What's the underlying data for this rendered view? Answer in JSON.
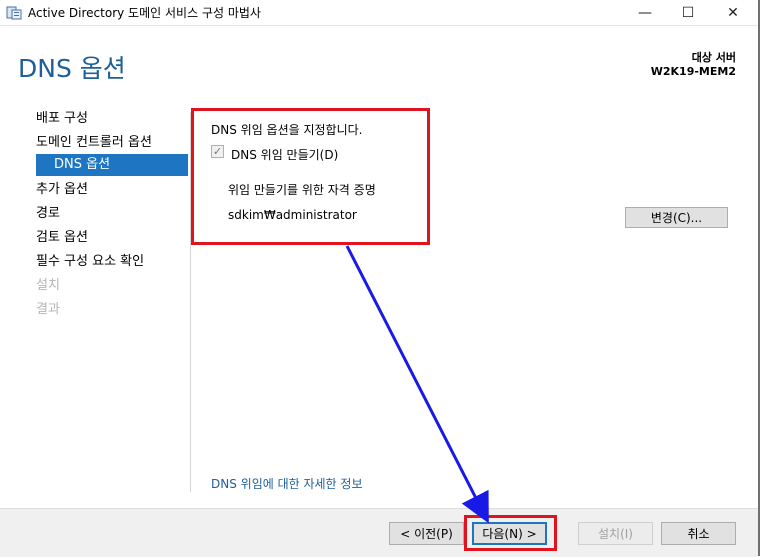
{
  "window": {
    "title": "Active Directory 도메인 서비스 구성 마법사",
    "controls": {
      "minimize": "—",
      "maximize": "☐",
      "close": "✕"
    }
  },
  "header": {
    "page_title": "DNS 옵션",
    "target_label": "대상 서버",
    "target_server": "W2K19-MEM2"
  },
  "nav": {
    "items": [
      {
        "label": "배포 구성",
        "state": "normal"
      },
      {
        "label": "도메인 컨트롤러 옵션",
        "state": "normal"
      },
      {
        "label": "DNS 옵션",
        "state": "selected"
      },
      {
        "label": "추가 옵션",
        "state": "normal"
      },
      {
        "label": "경로",
        "state": "normal"
      },
      {
        "label": "검토 옵션",
        "state": "normal"
      },
      {
        "label": "필수 구성 요소 확인",
        "state": "normal"
      },
      {
        "label": "설치",
        "state": "disabled"
      },
      {
        "label": "결과",
        "state": "disabled"
      }
    ]
  },
  "content": {
    "instruction": "DNS 위임 옵션을 지정합니다.",
    "checkbox_label": "DNS 위임 만들기(D)",
    "checkbox_checked": true,
    "credential_label": "위임 만들기를 위한 자격 증명",
    "credential_value": "sdkim₩administrator",
    "change_button": "변경(C)...",
    "more_info_link": "DNS 위임에 대한 자세한 정보"
  },
  "footer": {
    "prev_button": "< 이전(P)",
    "next_button": "다음(N) >",
    "install_button": "설치(I)",
    "cancel_button": "취소"
  },
  "colors": {
    "accent": "#1e75c2",
    "title_blue": "#1e5f9a",
    "annotation_red": "#e0141e",
    "annotation_arrow": "#1a1ae6"
  }
}
